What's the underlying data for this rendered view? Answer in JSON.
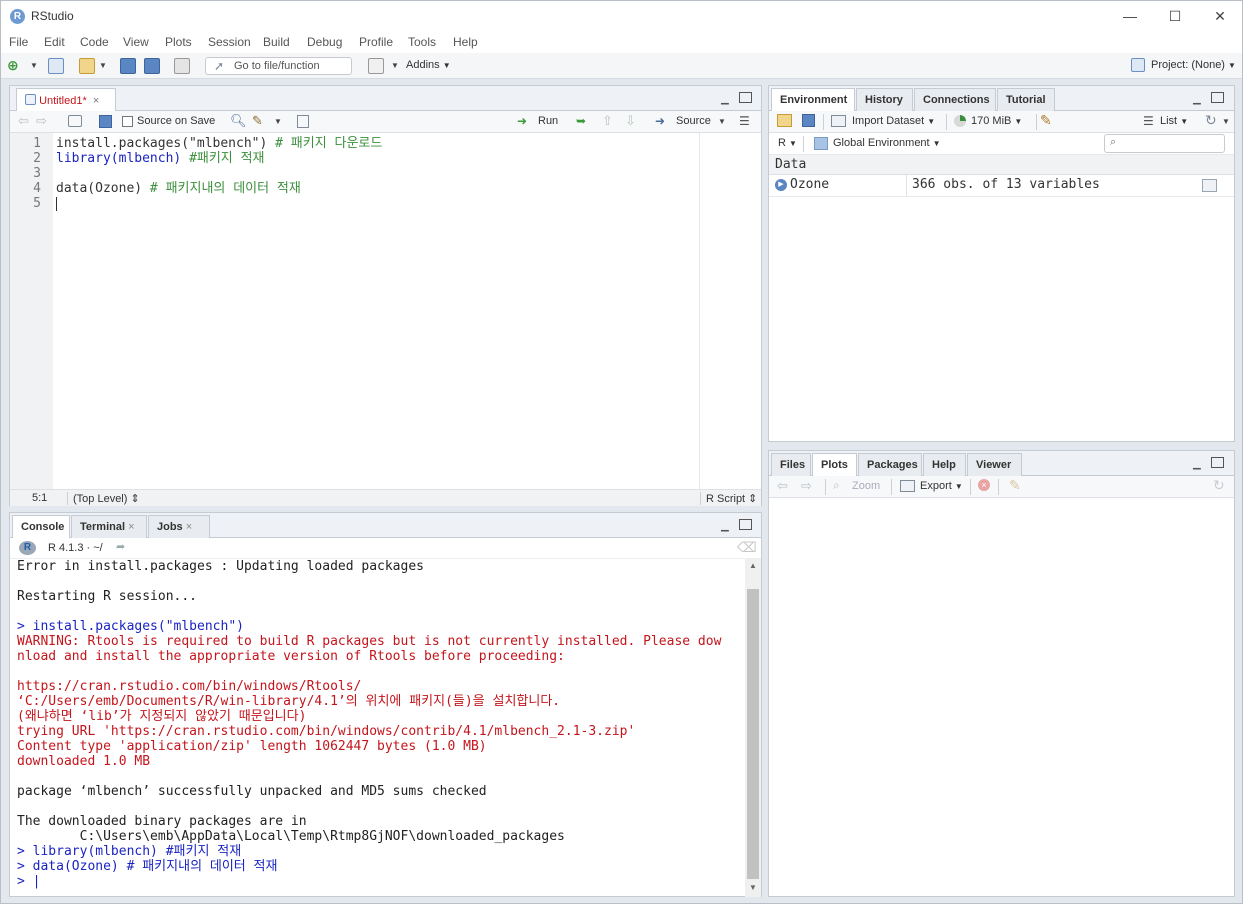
{
  "app": {
    "title": "RStudio",
    "logo_letter": "R"
  },
  "window_controls": {
    "minimize": "—",
    "maximize": "☐",
    "close": "✕"
  },
  "menu": [
    "File",
    "Edit",
    "Code",
    "View",
    "Plots",
    "Session",
    "Build",
    "Debug",
    "Profile",
    "Tools",
    "Help"
  ],
  "toolbar": {
    "goto_placeholder": "Go to file/function",
    "addins_label": "Addins",
    "project_label": "Project: (None)"
  },
  "editor": {
    "tab_label": "Untitled1*",
    "source_on_save_label": "Source on Save",
    "run_label": "Run",
    "source_label": "Source",
    "lines": [
      {
        "num": "1",
        "text": "install.packages(\"mlbench\") # 패키지 다운로드"
      },
      {
        "num": "2",
        "text": "library(mlbench) #패키지 적재"
      },
      {
        "num": "3",
        "text": ""
      },
      {
        "num": "4",
        "text": "data(Ozone) # 패키지내의 데이터 적재"
      },
      {
        "num": "5",
        "text": ""
      }
    ],
    "status_position": "5:1",
    "status_level": "(Top Level) ⇕",
    "status_type": "R Script ⇕"
  },
  "console": {
    "tabs": [
      "Console",
      "Terminal",
      "Jobs"
    ],
    "r_version": "R 4.1.3 · ~/",
    "lines": [
      {
        "text": "Error in install.packages : Updating loaded packages",
        "color": "black"
      },
      {
        "text": "",
        "color": "black"
      },
      {
        "text": "Restarting R session...",
        "color": "black"
      },
      {
        "text": "",
        "color": "black"
      },
      {
        "text": "> install.packages(\"mlbench\")",
        "color": "blue"
      },
      {
        "text": "WARNING: Rtools is required to build R packages but is not currently installed. Please dow",
        "color": "red"
      },
      {
        "text": "nload and install the appropriate version of Rtools before proceeding:",
        "color": "red"
      },
      {
        "text": "",
        "color": "red"
      },
      {
        "text": "https://cran.rstudio.com/bin/windows/Rtools/",
        "color": "red"
      },
      {
        "text": "‘C:/Users/emb/Documents/R/win-library/4.1’의 위치에 패키지(들)을 설치합니다.",
        "color": "red"
      },
      {
        "text": "(왜냐하면 ‘lib’가 지정되지 않았기 때문입니다)",
        "color": "red"
      },
      {
        "text": "trying URL 'https://cran.rstudio.com/bin/windows/contrib/4.1/mlbench_2.1-3.zip'",
        "color": "red"
      },
      {
        "text": "Content type 'application/zip' length 1062447 bytes (1.0 MB)",
        "color": "red"
      },
      {
        "text": "downloaded 1.0 MB",
        "color": "red"
      },
      {
        "text": "",
        "color": "black"
      },
      {
        "text": "package ‘mlbench’ successfully unpacked and MD5 sums checked",
        "color": "black"
      },
      {
        "text": "",
        "color": "black"
      },
      {
        "text": "The downloaded binary packages are in",
        "color": "black"
      },
      {
        "text": "        C:\\Users\\emb\\AppData\\Local\\Temp\\Rtmp8GjNOF\\downloaded_packages",
        "color": "black"
      },
      {
        "text": "> library(mlbench) #패키지 적재",
        "color": "blue"
      },
      {
        "text": "> data(Ozone) # 패키지내의 데이터 적재",
        "color": "blue"
      },
      {
        "text": "> |",
        "color": "blue"
      }
    ]
  },
  "environment": {
    "tabs": [
      "Environment",
      "History",
      "Connections",
      "Tutorial"
    ],
    "import_dataset_label": "Import Dataset",
    "memory_label": "170 MiB",
    "list_label": "List",
    "r_label": "R",
    "scope_label": "Global Environment",
    "section_header": "Data",
    "rows": [
      {
        "name": "Ozone",
        "value": "366 obs. of 13 variables"
      }
    ]
  },
  "files": {
    "tabs": [
      "Files",
      "Plots",
      "Packages",
      "Help",
      "Viewer"
    ],
    "zoom_label": "Zoom",
    "export_label": "Export"
  }
}
